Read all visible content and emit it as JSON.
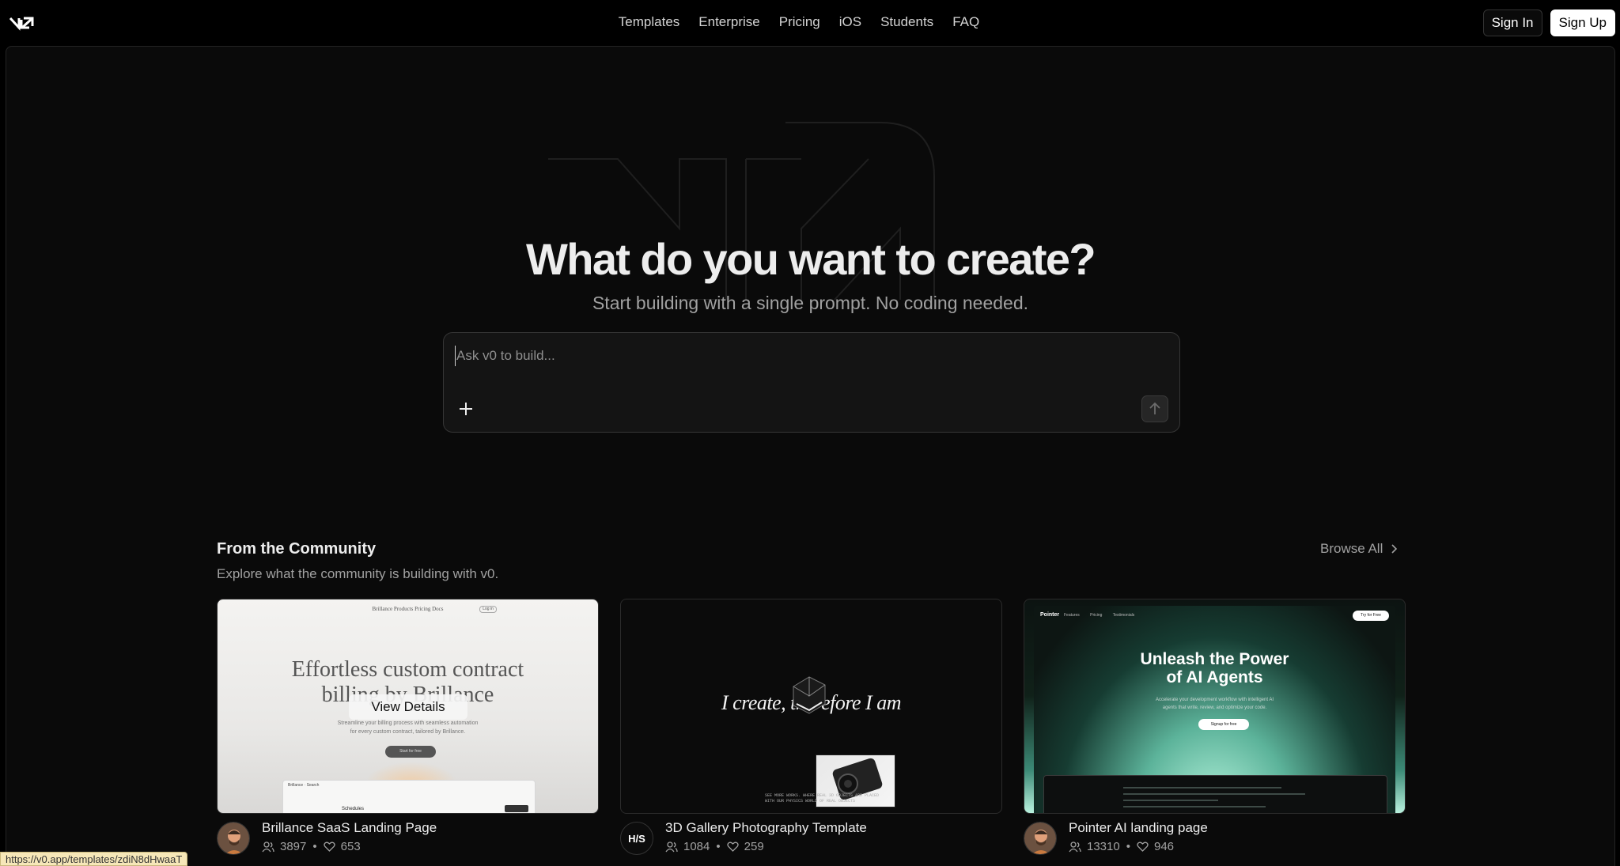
{
  "nav": {
    "links": [
      "Templates",
      "Enterprise",
      "Pricing",
      "iOS",
      "Students",
      "FAQ"
    ],
    "sign_in": "Sign In",
    "sign_up": "Sign Up"
  },
  "hero": {
    "title": "What do you want to create?",
    "subtitle": "Start building with a single prompt. No coding needed.",
    "prompt_placeholder": "Ask v0 to build..."
  },
  "community": {
    "title": "From the Community",
    "subtitle": "Explore what the community is building with v0.",
    "browse_all": "Browse All",
    "view_details": "View Details",
    "cards": [
      {
        "title": "Brillance SaaS Landing Page",
        "users": "3897",
        "likes": "653",
        "preview": {
          "nav": "Brillance   Products   Pricing   Docs",
          "login": "Log in",
          "headline_1": "Effortless custom contract",
          "headline_2": "billing by Brillance",
          "body_1": "Streamline your billing process with seamless automation",
          "body_2": "for every custom contract, tailored by Brillance.",
          "cta": "Start for free",
          "panel_top": "Brillance  ·  Search",
          "panel_item": "Schedules"
        }
      },
      {
        "title": "3D Gallery Photography Template",
        "users": "1084",
        "likes": "259",
        "avatar_text": "H/S",
        "preview": {
          "text": "I create, therefore I am",
          "caption_1": "SEE MORE WORKS. WHERE REAL 3D OBJECTS ARE PLACED",
          "caption_2": "WITH OUR PHYSICS WORLD OF REAL OBJECTS"
        }
      },
      {
        "title": "Pointer AI landing page",
        "users": "13310",
        "likes": "946",
        "preview": {
          "brand": "Pointer",
          "nav": "Features Pricing Testimonials",
          "try": "Try for Free",
          "headline_1": "Unleash the Power",
          "headline_2": "of AI Agents",
          "body_1": "Accelerate your development workflow with intelligent AI",
          "body_2": "agents that write, review, and optimize your code.",
          "cta": "Signup for free"
        }
      }
    ]
  },
  "status_url": "https://v0.app/templates/zdiN8dHwaaT",
  "colors": {
    "background": "#000000",
    "surface": "#0a0a0a",
    "text": "#ededed",
    "muted": "#a1a1a1"
  }
}
